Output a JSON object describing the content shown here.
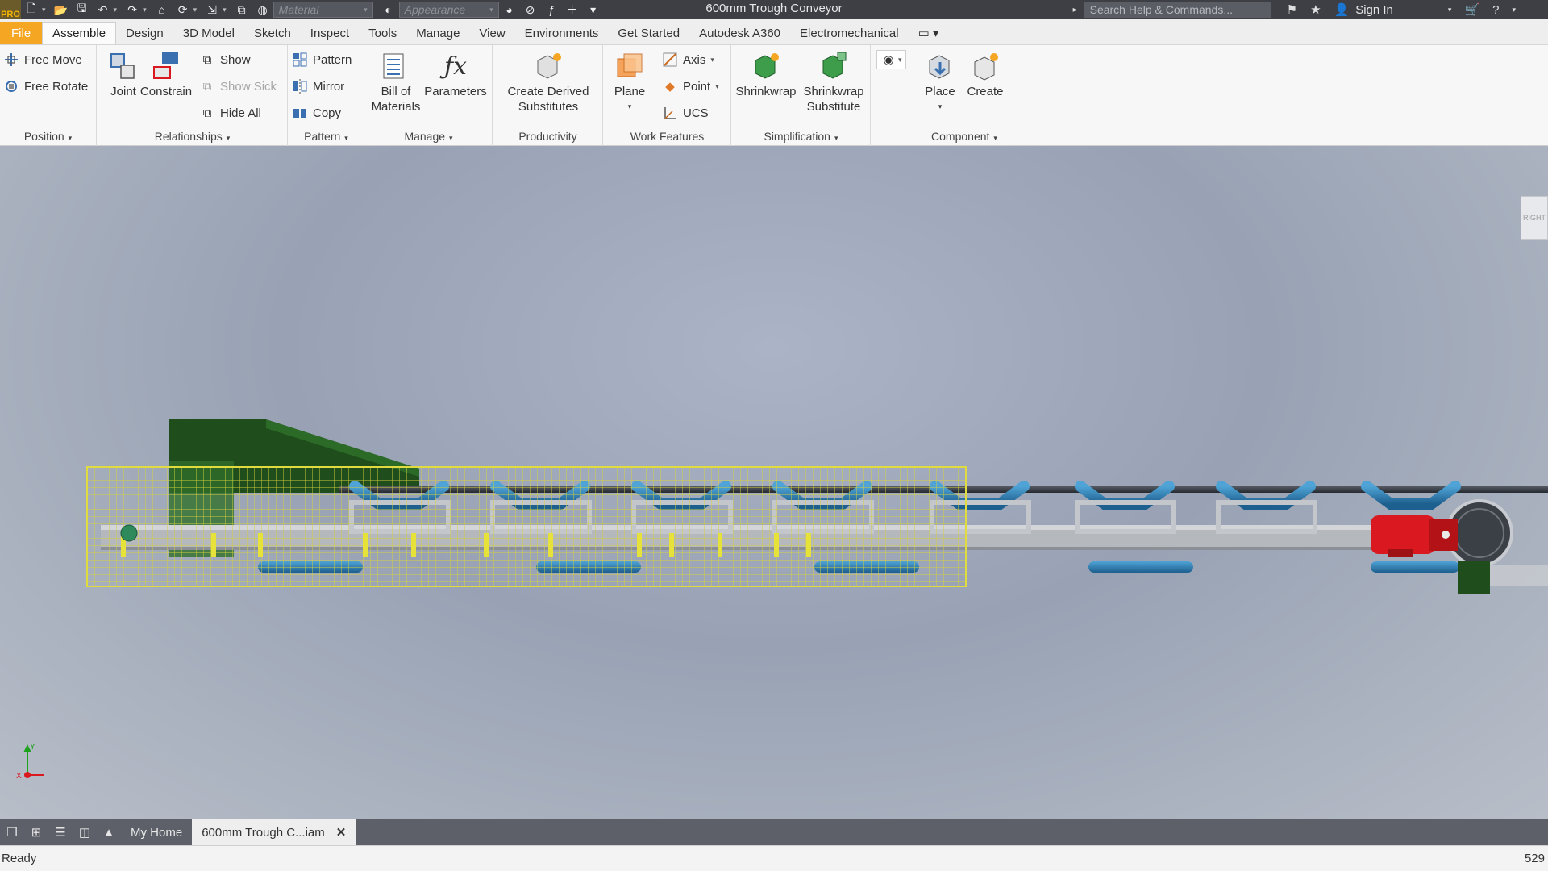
{
  "titlebar": {
    "title": "600mm Trough Conveyor",
    "material_placeholder": "Material",
    "appearance_placeholder": "Appearance",
    "search_placeholder": "Search Help & Commands...",
    "sign_in": "Sign In",
    "logo_text": "PRO"
  },
  "tabs": [
    "File",
    "Assemble",
    "Design",
    "3D Model",
    "Sketch",
    "Inspect",
    "Tools",
    "Manage",
    "View",
    "Environments",
    "Get Started",
    "Autodesk A360",
    "Electromechanical"
  ],
  "active_tab": "Assemble",
  "ribbon": {
    "position": {
      "label": "Position",
      "free_move": "Free Move",
      "free_rotate": "Free Rotate"
    },
    "relationships": {
      "label": "Relationships",
      "joint": "Joint",
      "constrain": "Constrain",
      "show": "Show",
      "show_sick": "Show Sick",
      "hide_all": "Hide All"
    },
    "pattern": {
      "label": "Pattern",
      "pattern": "Pattern",
      "mirror": "Mirror",
      "copy": "Copy"
    },
    "manage": {
      "label": "Manage",
      "bom_line1": "Bill of",
      "bom_line2": "Materials",
      "parameters": "Parameters"
    },
    "productivity": {
      "label": "Productivity",
      "cds_line1": "Create Derived",
      "cds_line2": "Substitutes"
    },
    "work_features": {
      "label": "Work Features",
      "plane": "Plane",
      "axis": "Axis",
      "point": "Point",
      "ucs": "UCS"
    },
    "simplification": {
      "label": "Simplification",
      "shrinkwrap": "Shrinkwrap",
      "shrinkwrap_sub_line1": "Shrinkwrap",
      "shrinkwrap_sub_line2": "Substitute"
    },
    "component": {
      "label": "Component",
      "place": "Place",
      "create": "Create"
    }
  },
  "viewport": {
    "viewcube_label": "RIGHT",
    "triad_x": "X",
    "triad_y": "Y"
  },
  "doctabs": {
    "home": "My Home",
    "active": "600mm Trough C...iam"
  },
  "status": {
    "left": "Ready",
    "right": "529"
  },
  "colors": {
    "file_tab": "#f5a623",
    "roller_blue": "#2b7fb5",
    "motor_red": "#d9191f",
    "chute_green": "#1f4d1c",
    "guard_yellow": "#d6d23a",
    "frame_grey": "#b5b8bd"
  }
}
